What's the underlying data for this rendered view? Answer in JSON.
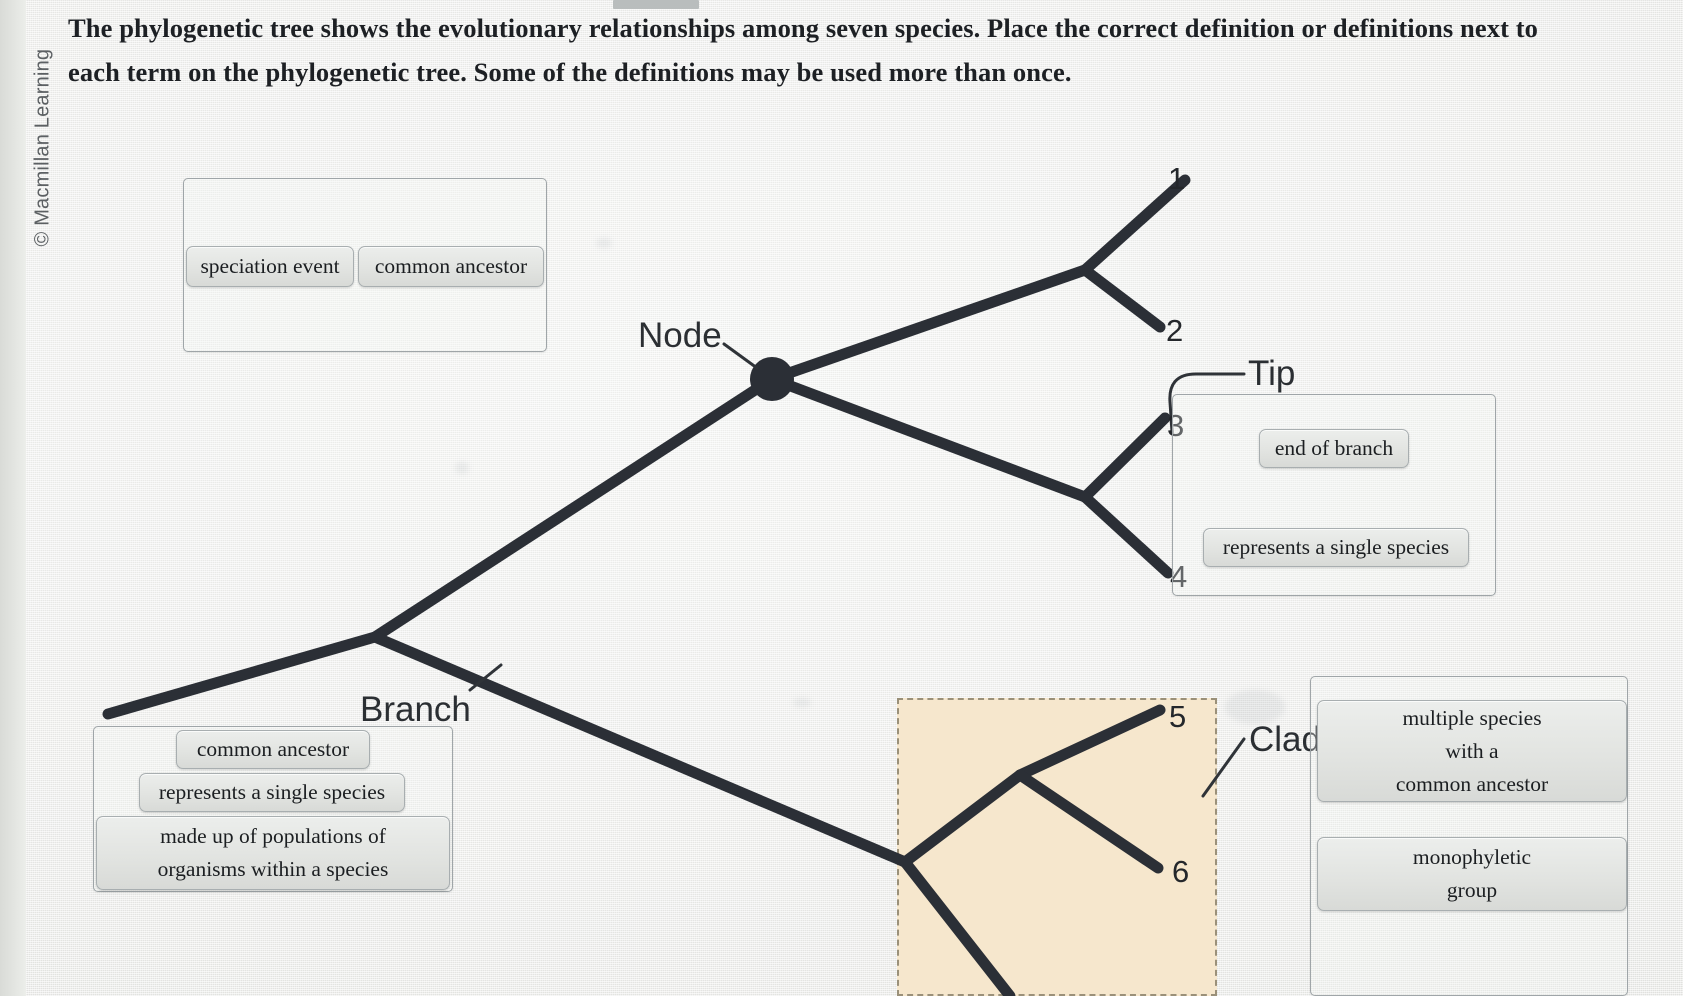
{
  "meta": {
    "copyright": "© Macmillan Learning"
  },
  "prompt": {
    "text": "The phylogenetic tree shows the evolutionary relationships among seven species. Place the correct definition or definitions next to each term on the phylogenetic tree. Some of the definitions may be used more than once."
  },
  "tree": {
    "tip_numbers": [
      "1",
      "2",
      "3",
      "4",
      "5",
      "6"
    ],
    "labels": {
      "node": "Node",
      "tip": "Tip",
      "branch": "Branch",
      "clade": "Clade"
    },
    "colors": {
      "branch": "#2b2f36",
      "node_dot": "#2b2f36",
      "clade_highlight_fill": "#f6e7cd",
      "clade_highlight_border": "#9a9079"
    }
  },
  "dropzones": [
    {
      "name": "node-dropzone",
      "chips": [
        "speciation event",
        "common ancestor"
      ]
    },
    {
      "name": "tip-dropzone",
      "chips": [
        "end of branch",
        "represents a single species"
      ]
    },
    {
      "name": "branch-dropzone",
      "chips": [
        "common ancestor",
        "represents a single species",
        "made up of populations of organisms within a species"
      ]
    },
    {
      "name": "clade-dropzone",
      "chips": [
        "multiple species with a common ancestor",
        "monophyletic group"
      ]
    }
  ],
  "chips": {
    "speciation_event": "speciation event",
    "common_ancestor": "common ancestor",
    "end_of_branch": "end of branch",
    "represents_single_species": "represents a single species",
    "branch_common_ancestor": "common ancestor",
    "branch_single_species": "represents a single species",
    "made_up_line1": "made up of populations of",
    "made_up_line2": "organisms within a species",
    "clade_line1": "multiple species",
    "clade_line2": "with a",
    "clade_line3": "common ancestor",
    "mono_line1": "monophyletic",
    "mono_line2": "group"
  }
}
